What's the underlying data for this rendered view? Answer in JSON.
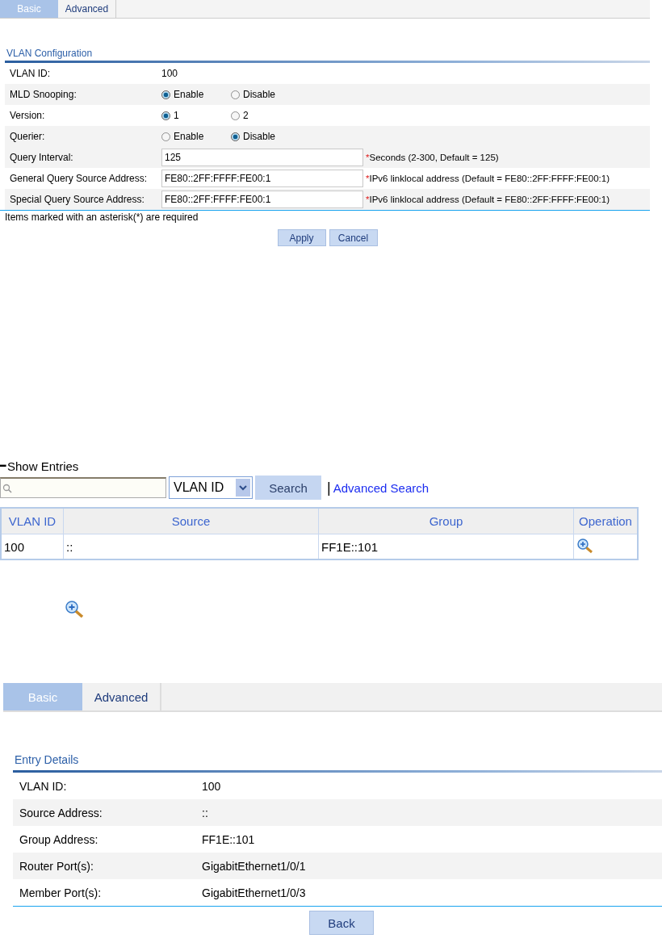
{
  "config_panel": {
    "tabs": [
      {
        "label": "Basic",
        "selected": true
      },
      {
        "label": "Advanced",
        "selected": false
      }
    ],
    "title": "VLAN Configuration",
    "rows": [
      {
        "kind": "text",
        "label": "VLAN ID:",
        "value": "100",
        "shaded": false
      },
      {
        "kind": "radio",
        "label": "MLD Snooping:",
        "shaded": true,
        "options": [
          {
            "label": "Enable",
            "selected": true
          },
          {
            "label": "Disable",
            "selected": false
          }
        ]
      },
      {
        "kind": "radio",
        "label": "Version:",
        "shaded": false,
        "options": [
          {
            "label": "1",
            "selected": true
          },
          {
            "label": "2",
            "selected": false
          }
        ]
      },
      {
        "kind": "radio",
        "label": "Querier:",
        "shaded": true,
        "options": [
          {
            "label": "Enable",
            "selected": false
          },
          {
            "label": "Disable",
            "selected": true
          }
        ]
      },
      {
        "kind": "input",
        "label": "Query Interval:",
        "value": "125",
        "mark": "*",
        "note": "Seconds (2-300, Default = 125)",
        "shaded": true
      },
      {
        "kind": "input",
        "label": "General Query Source Address:",
        "value": "FE80::2FF:FFFF:FE00:1",
        "mark": "*",
        "note": "IPv6 linklocal address (Default = FE80::2FF:FFFF:FE00:1)",
        "shaded": false
      },
      {
        "kind": "input",
        "label": "Special Query Source Address:",
        "value": "FE80::2FF:FFFF:FE00:1",
        "mark": "*",
        "note": "IPv6 linklocal address (Default = FE80::2FF:FFFF:FE00:1)",
        "shaded": true
      }
    ],
    "footnote": "Items marked with an asterisk(*) are required",
    "buttons": [
      "Apply",
      "Cancel"
    ]
  },
  "entries_panel": {
    "toggle": "━",
    "title": "Show Entries",
    "search_by": "VLAN ID",
    "search_button": "Search",
    "separator": "|",
    "advanced_link": "Advanced Search",
    "table": {
      "columns": [
        "VLAN ID",
        "Source",
        "Group",
        "Operation"
      ],
      "rows": [
        {
          "vlan_id": "100",
          "source": "::",
          "group": "FF1E::101"
        }
      ]
    }
  },
  "details_panel": {
    "tabs": [
      {
        "label": "Basic",
        "selected": true
      },
      {
        "label": "Advanced",
        "selected": false
      }
    ],
    "title": "Entry Details",
    "rows": [
      {
        "label": "VLAN ID:",
        "value": "100",
        "shaded": false
      },
      {
        "label": "Source Address:",
        "value": "::",
        "shaded": true
      },
      {
        "label": "Group Address:",
        "value": "FF1E::101",
        "shaded": false
      },
      {
        "label": "Router Port(s):",
        "value": "GigabitEthernet1/0/1",
        "shaded": true
      },
      {
        "label": "Member Port(s):",
        "value": "GigabitEthernet1/0/3",
        "shaded": false
      }
    ],
    "button": "Back"
  }
}
